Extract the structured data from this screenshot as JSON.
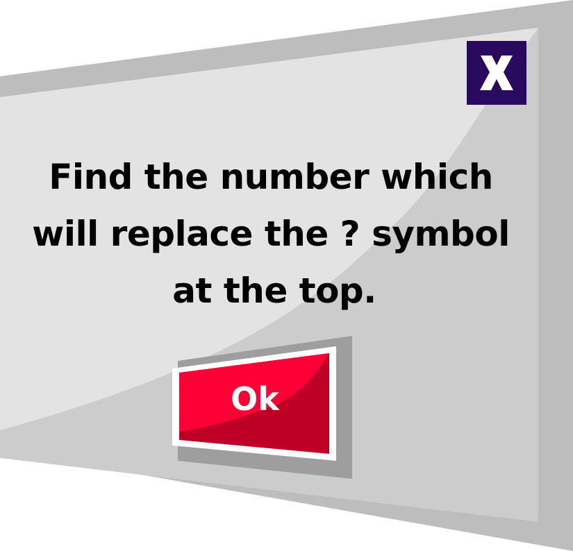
{
  "dialog": {
    "message_lines": [
      "Find the number which",
      "will replace the ? symbol",
      "at the top."
    ],
    "close_icon": "close-x-icon",
    "ok_label": "Ok"
  },
  "colors": {
    "panel_gray": "#cccccc",
    "panel_light": "#e3e3e3",
    "close_bg": "#2a0a5e",
    "ok_red": "#ff0036",
    "ok_dark_red": "#bf0026"
  }
}
